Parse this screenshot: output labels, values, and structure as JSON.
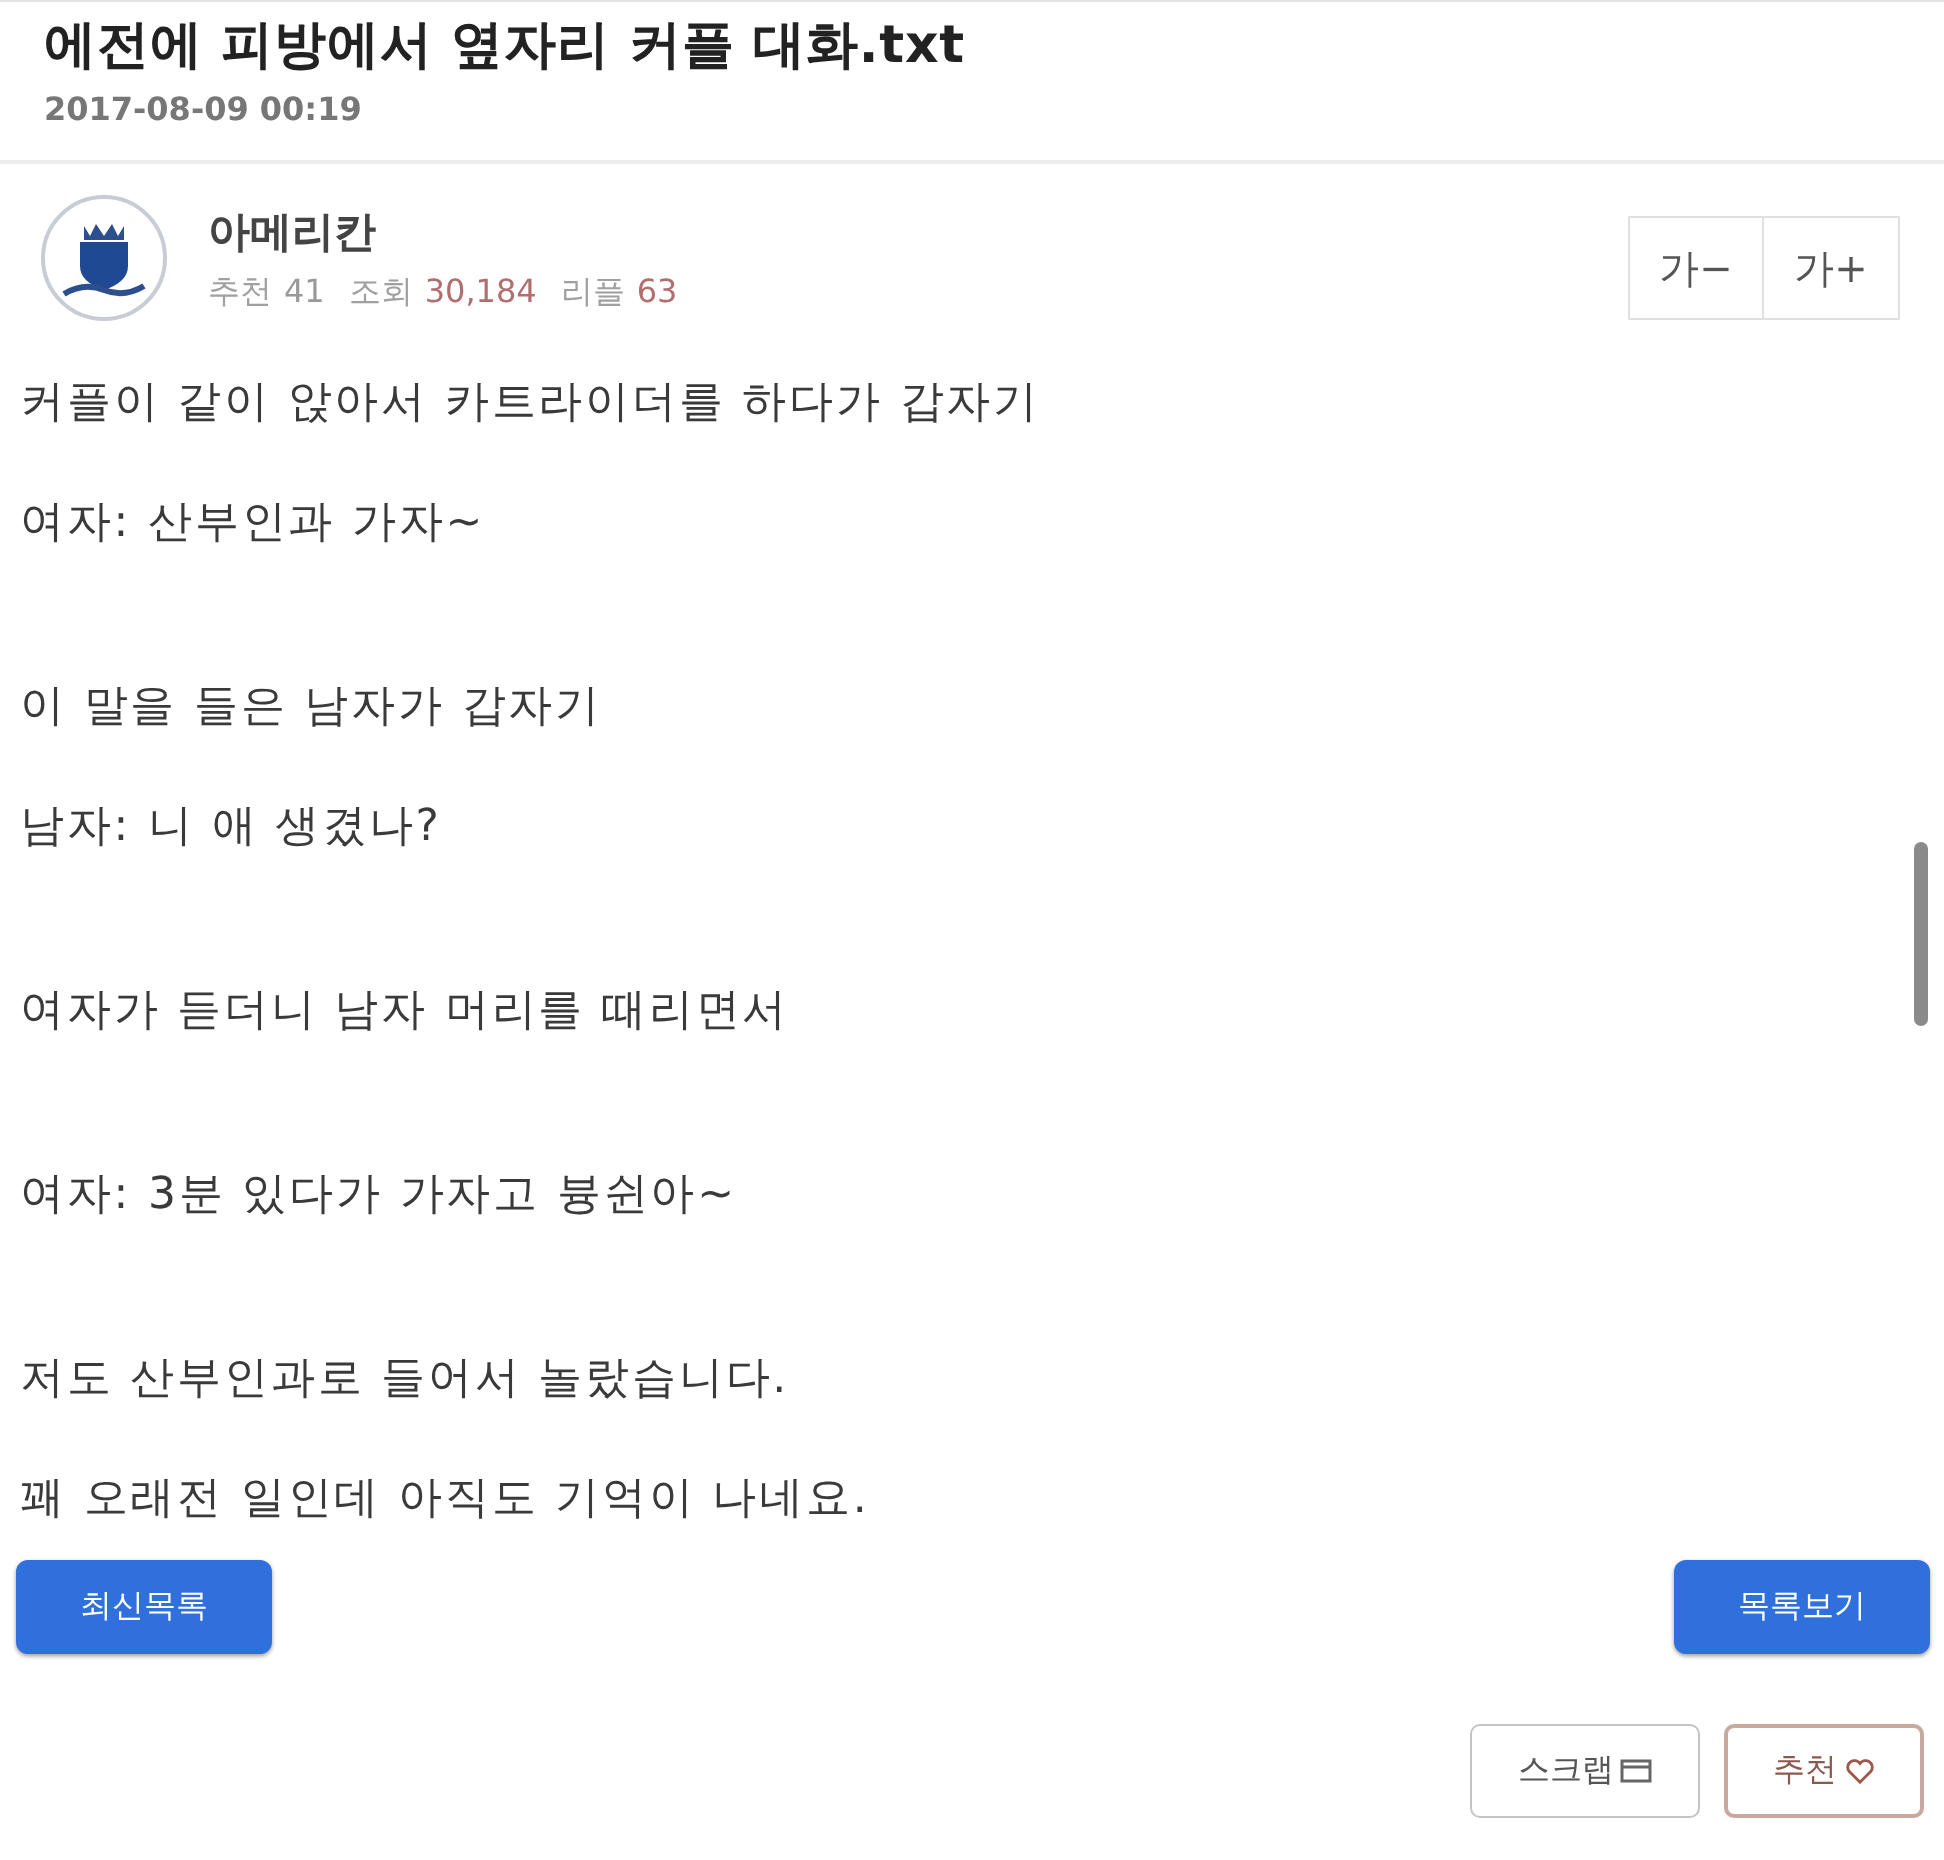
{
  "post": {
    "title": "에전에 피방에서 옆자리 커플 대화.txt",
    "date": "2017-08-09 00:19"
  },
  "author": {
    "name": "아메리칸",
    "stats": [
      {
        "label": "추천",
        "value": "41",
        "highlight": false
      },
      {
        "label": "조회",
        "value": "30,184",
        "highlight": true
      },
      {
        "label": "리플",
        "value": "63",
        "highlight": true
      }
    ]
  },
  "font_buttons": [
    "가−",
    "가+"
  ],
  "body": [
    {
      "lines": [
        "커플이 같이 앉아서 카트라이더를 하다가 갑자기",
        "여자: 산부인과 가자~"
      ]
    },
    {
      "lines": [
        "이 말을 들은 남자가 갑자기",
        "남자: 니 애 생겼나?"
      ]
    },
    {
      "lines": [
        "여자가 듣더니 남자 머리를 때리면서"
      ]
    },
    {
      "lines": [
        "여자: 3분 있다가 가자고 븅쉰아~"
      ]
    },
    {
      "lines": [
        "저도 산부인과로 들어서 놀랐습니다.",
        "꽤 오래전 일인데 아직도 기억이 나네요."
      ]
    }
  ],
  "nav_buttons": [
    {
      "label": "최신목록"
    },
    {
      "label": "목록보기"
    }
  ],
  "action_buttons": [
    {
      "label": "스크랩",
      "kind": "scrap"
    },
    {
      "label": "추천",
      "kind": "recommend"
    }
  ]
}
